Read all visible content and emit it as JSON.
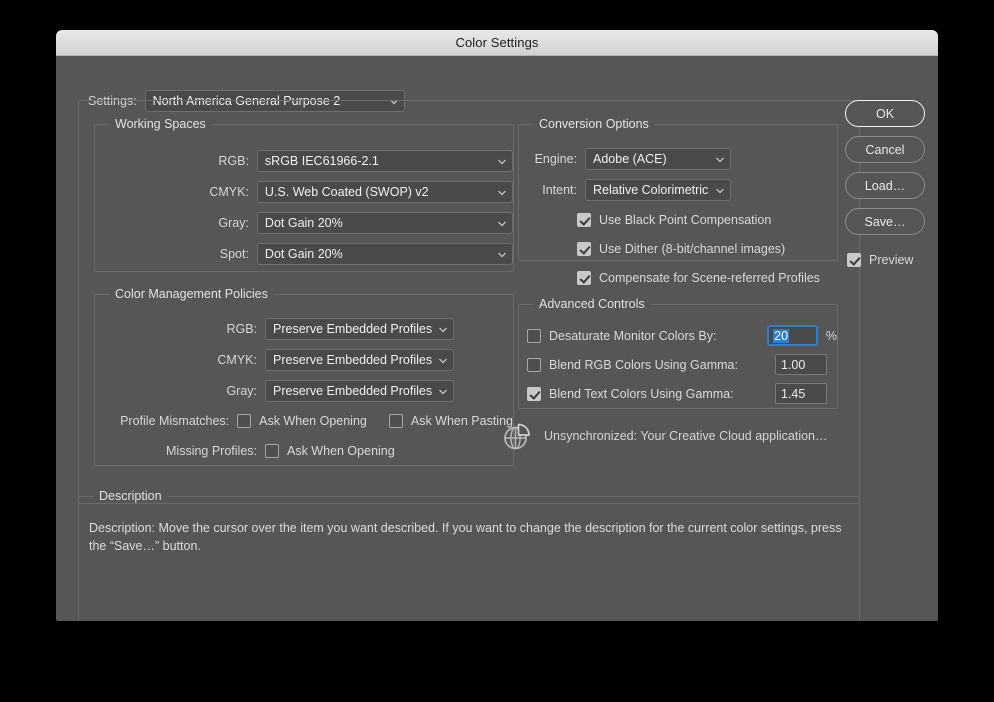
{
  "window": {
    "title": "Color Settings"
  },
  "settings_row": {
    "label": "Settings:",
    "value": "North America General Purpose 2"
  },
  "working_spaces": {
    "legend": "Working Spaces",
    "rows": [
      {
        "label": "RGB:",
        "value": "sRGB IEC61966-2.1"
      },
      {
        "label": "CMYK:",
        "value": "U.S. Web Coated (SWOP) v2"
      },
      {
        "label": "Gray:",
        "value": "Dot Gain 20%"
      },
      {
        "label": "Spot:",
        "value": "Dot Gain 20%"
      }
    ]
  },
  "color_management_policies": {
    "legend": "Color Management Policies",
    "rows": [
      {
        "label": "RGB:",
        "value": "Preserve Embedded Profiles"
      },
      {
        "label": "CMYK:",
        "value": "Preserve Embedded Profiles"
      },
      {
        "label": "Gray:",
        "value": "Preserve Embedded Profiles"
      }
    ],
    "profile_mismatches": {
      "label": "Profile Mismatches:",
      "ask_when_opening": "Ask When Opening",
      "ask_when_pasting": "Ask When Pasting"
    },
    "missing_profiles": {
      "label": "Missing Profiles:",
      "ask_when_opening": "Ask When Opening"
    }
  },
  "conversion_options": {
    "legend": "Conversion Options",
    "engine": {
      "label": "Engine:",
      "value": "Adobe (ACE)"
    },
    "intent": {
      "label": "Intent:",
      "value": "Relative Colorimetric"
    },
    "checkboxes": [
      {
        "label": "Use Black Point Compensation",
        "checked": true
      },
      {
        "label": "Use Dither (8-bit/channel images)",
        "checked": true
      },
      {
        "label": "Compensate for Scene-referred Profiles",
        "checked": true
      }
    ]
  },
  "advanced_controls": {
    "legend": "Advanced Controls",
    "rows": [
      {
        "label": "Desaturate Monitor Colors By:",
        "checked": false,
        "value": "20",
        "suffix": "%",
        "focused": true
      },
      {
        "label": "Blend RGB Colors Using Gamma:",
        "checked": false,
        "value": "1.00",
        "suffix": "",
        "focused": false
      },
      {
        "label": "Blend Text Colors Using Gamma:",
        "checked": true,
        "value": "1.45",
        "suffix": "",
        "focused": false
      }
    ]
  },
  "sync_status": {
    "icon": "sync-globe-icon",
    "text": "Unsynchronized: Your Creative Cloud application…"
  },
  "description": {
    "legend": "Description",
    "text": "Description:  Move the cursor over the item you want described.  If you want to change the description for the current color settings, press the “Save…” button."
  },
  "buttons": {
    "ok": "OK",
    "cancel": "Cancel",
    "load": "Load…",
    "save": "Save…",
    "preview": "Preview",
    "preview_checked": true
  },
  "colors": {
    "dialog_bg": "#565656",
    "field_bg": "#4a4a4a",
    "accent_selection": "#2f7fd0",
    "text": "#e2e2e2"
  }
}
